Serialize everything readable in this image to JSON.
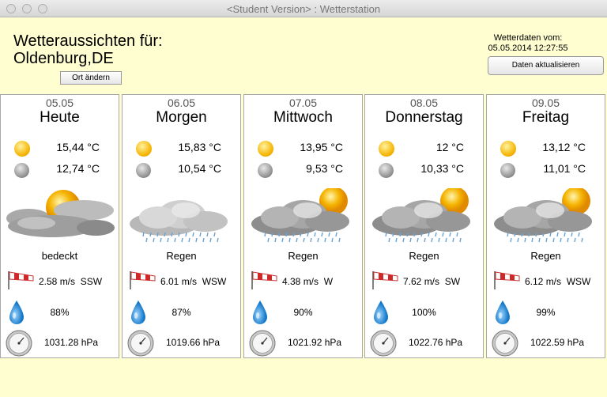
{
  "window": {
    "title": "<Student Version> : Wetterstation"
  },
  "header": {
    "line1": "Wetteraussichten für:",
    "location": "Oldenburg,DE",
    "change_location_label": "Ort ändern",
    "data_from_label": "Wetterdaten vom:",
    "data_timestamp": "05.05.2014 12:27:55",
    "refresh_label": "Daten aktualisieren"
  },
  "forecast": [
    {
      "date": "05.05",
      "day": "Heute",
      "temp_day": "15,44 °C",
      "temp_night": "12,74 °C",
      "condition": "bedeckt",
      "icon": "sun-behind-clouds-icon",
      "wind": "2.58 m/s  SSW",
      "humidity": "88%",
      "pressure": "1031.28 hPa"
    },
    {
      "date": "06.05",
      "day": "Morgen",
      "temp_day": "15,83 °C",
      "temp_night": "10,54 °C",
      "condition": "Regen",
      "icon": "rain-cloud-icon",
      "wind": "6.01 m/s  WSW",
      "humidity": "87%",
      "pressure": "1019.66 hPa"
    },
    {
      "date": "07.05",
      "day": "Mittwoch",
      "temp_day": "13,95 °C",
      "temp_night": "9,53 °C",
      "condition": "Regen",
      "icon": "sun-rain-cloud-icon",
      "wind": "4.38 m/s  W",
      "humidity": "90%",
      "pressure": "1021.92 hPa"
    },
    {
      "date": "08.05",
      "day": "Donnerstag",
      "temp_day": "12 °C",
      "temp_night": "10,33 °C",
      "condition": "Regen",
      "icon": "sun-rain-cloud-icon",
      "wind": "7.62 m/s  SW",
      "humidity": "100%",
      "pressure": "1022.76 hPa"
    },
    {
      "date": "09.05",
      "day": "Freitag",
      "temp_day": "13,12 °C",
      "temp_night": "11,01 °C",
      "condition": "Regen",
      "icon": "sun-rain-cloud-icon",
      "wind": "6.12 m/s  WSW",
      "humidity": "99%",
      "pressure": "1022.59 hPa"
    }
  ],
  "colors": {
    "background": "#fffed0",
    "card": "#ffffff",
    "sun": "#f5b400"
  }
}
